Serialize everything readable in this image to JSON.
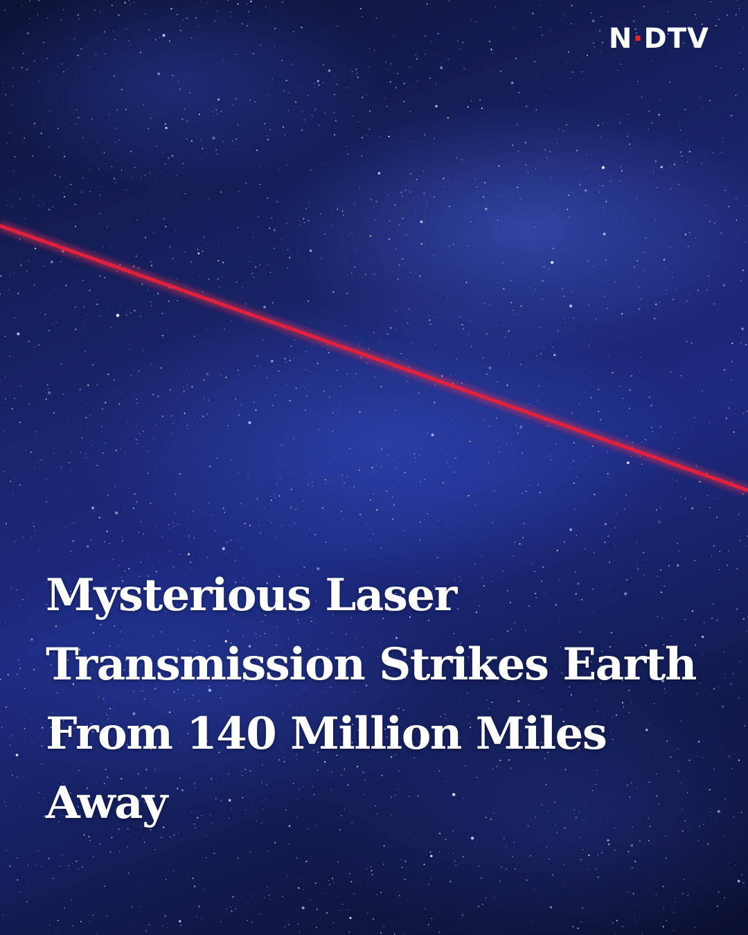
{
  "brand": {
    "logo_text": "NDTV",
    "logo_parts": [
      "N",
      "D",
      "T",
      "V"
    ],
    "accent_color": "#e5262c"
  },
  "headline": {
    "lines": [
      "Mysterious Laser",
      "Transmission Strikes Earth",
      "From 140 Million Miles",
      "Away"
    ]
  },
  "image": {
    "subject": "night-sky-with-red-laser-beam",
    "sky_color": "#1c2a80",
    "laser_color": "#e0203c"
  }
}
